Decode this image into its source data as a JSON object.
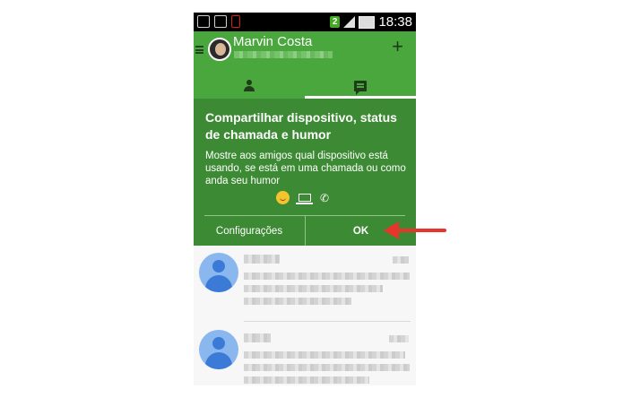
{
  "statusbar": {
    "time": "18:38",
    "notification_count": "2"
  },
  "appbar": {
    "user_name": "Marvin Costa",
    "add_icon": "plus-icon",
    "menu_icon": "menu-icon"
  },
  "tabs": [
    {
      "icon": "person-icon",
      "selected": false
    },
    {
      "icon": "chat-icon",
      "selected": true
    }
  ],
  "card": {
    "title": "Compartilhar dispositivo, status de chamada e humor",
    "body": "Mostre aos amigos qual dispositivo está usando, se está em uma chamada ou como anda seu humor",
    "icons": [
      "smile-icon",
      "laptop-icon",
      "phone-icon"
    ],
    "settings_label": "Configurações",
    "ok_label": "OK",
    "background_color": "#3d8a34"
  },
  "colors": {
    "accent_green": "#4aa73e",
    "arrow_red": "#e8352c",
    "avatar_blue": "#8bb7ef"
  }
}
